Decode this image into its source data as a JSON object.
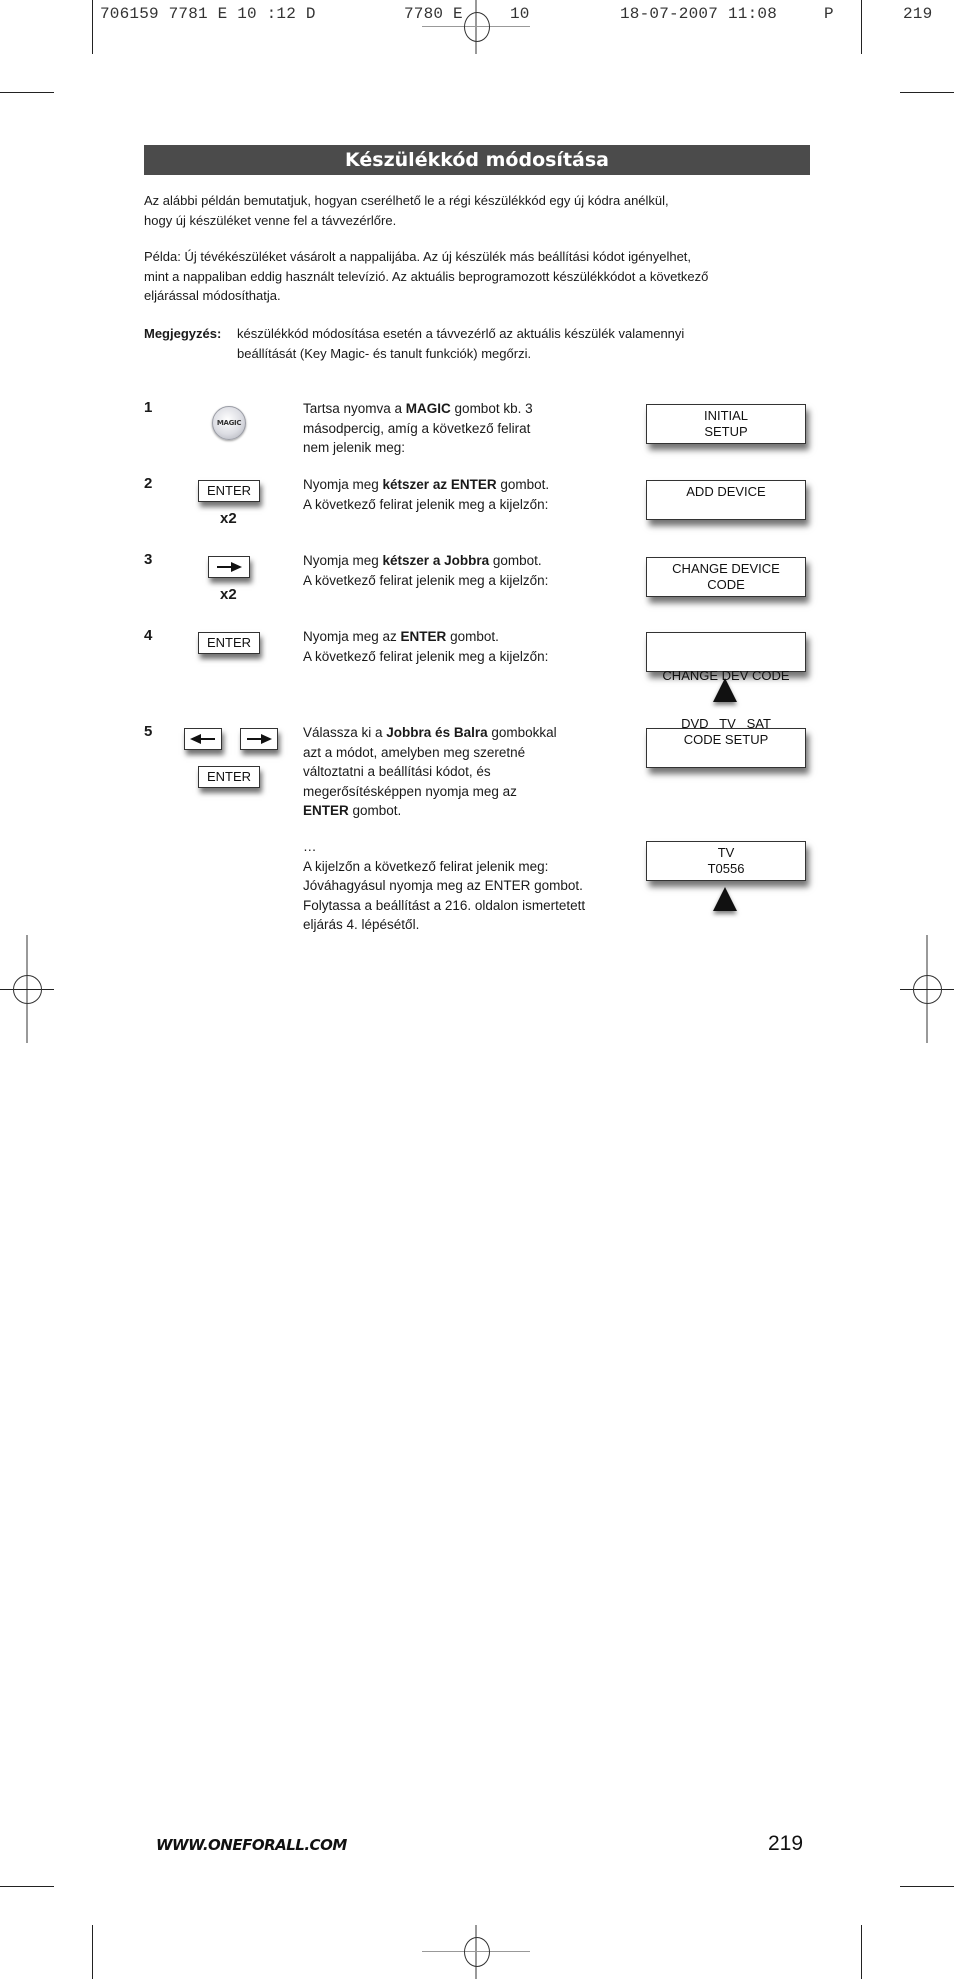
{
  "print_header": {
    "job": "706159 7781 E 10 :12 D",
    "file": "7780 E",
    "page_ref": "10",
    "date": "18-07-2007",
    "time": "11:08",
    "plate": "P",
    "page": "219"
  },
  "title": "Készülékkód módosítása",
  "intro": {
    "line1": "Az alábbi példán bemutatjuk, hogyan cserélhető le a régi készülékkód egy új kódra anélkül,",
    "line2": "hogy új készüléket venne fel a távvezérlőre."
  },
  "example": {
    "line1": "Példa: Új tévékészüléket vásárolt a nappalijába. Az új készülék más beállítási kódot igényelhet,",
    "line2": "mint a nappaliban eddig használt televízió. Az aktuális beprogramozott készülékkódot a következő",
    "line3": "eljárással módosíthatja."
  },
  "note": {
    "label": "Megjegyzés:",
    "line1": "készülékkód módosítása esetén a távvezérlő az aktuális készülék valamennyi",
    "line2": "beállítását (Key Magic- és tanult funkciók) megőrzi."
  },
  "steps": [
    {
      "number": "1",
      "key": "MAGIC",
      "text": {
        "l1a": "Tartsa nyomva a ",
        "l1b": "MAGIC",
        "l1c": " gombot kb. 3",
        "l2": "másodpercig, amíg a következő felirat",
        "l3": "nem jelenik meg:"
      },
      "display": [
        "INITIAL",
        "SETUP"
      ]
    },
    {
      "number": "2",
      "key": "ENTER",
      "repeat": "x2",
      "text": {
        "l1a": "Nyomja meg ",
        "l1b": "kétszer az ENTER",
        "l1c": " gombot.",
        "l2": "A következő felirat jelenik meg a kijelzőn:"
      },
      "display": [
        "ADD DEVICE"
      ]
    },
    {
      "number": "3",
      "key": "right-arrow",
      "repeat": "x2",
      "text": {
        "l1a": "Nyomja meg ",
        "l1b": "kétszer a Jobbra",
        "l1c": " gombot.",
        "l2": "A következő felirat jelenik meg a kijelzőn:"
      },
      "display": [
        "CHANGE DEVICE",
        "CODE"
      ]
    },
    {
      "number": "4",
      "key": "ENTER",
      "text": {
        "l1a": "Nyomja meg az ",
        "l1b": "ENTER",
        "l1c": " gombot.",
        "l2": "A következő felirat jelenik meg a kijelzőn:"
      },
      "display": [
        "CHANGE DEV CODE",
        "DVD   TV   SAT"
      ]
    },
    {
      "number": "5",
      "keys": [
        "left-arrow",
        "right-arrow",
        "ENTER"
      ],
      "text": {
        "l1a": "Válassza ki a ",
        "l1b": "Jobbra és Balra",
        "l1c": " gombokkal",
        "l2": "azt a módot, amelyben meg szeretné",
        "l3": "változtatni a beállítási kódot, és",
        "l4": "megerősítésképpen nyomja meg az",
        "l5a": "ENTER",
        "l5b": " gombot."
      },
      "display": [
        "CODE SETUP"
      ]
    }
  ],
  "continuation": {
    "ellipsis": "…",
    "l1": "A kijelzőn a következő felirat jelenik meg:",
    "l2": "Jóváhagyásul nyomja meg az ENTER gombot.",
    "l3": "Folytassa a beállítást a 216. oldalon ismertetett",
    "l4": "eljárás 4. lépésétől.",
    "display": [
      "TV",
      "T0556"
    ]
  },
  "footer": {
    "url": "WWW.ONEFORALL.COM",
    "page_number": "219"
  },
  "colors": {
    "title_bar": "#4b4b4b",
    "title_text": "#ffffff",
    "text": "#1a1a1a"
  }
}
